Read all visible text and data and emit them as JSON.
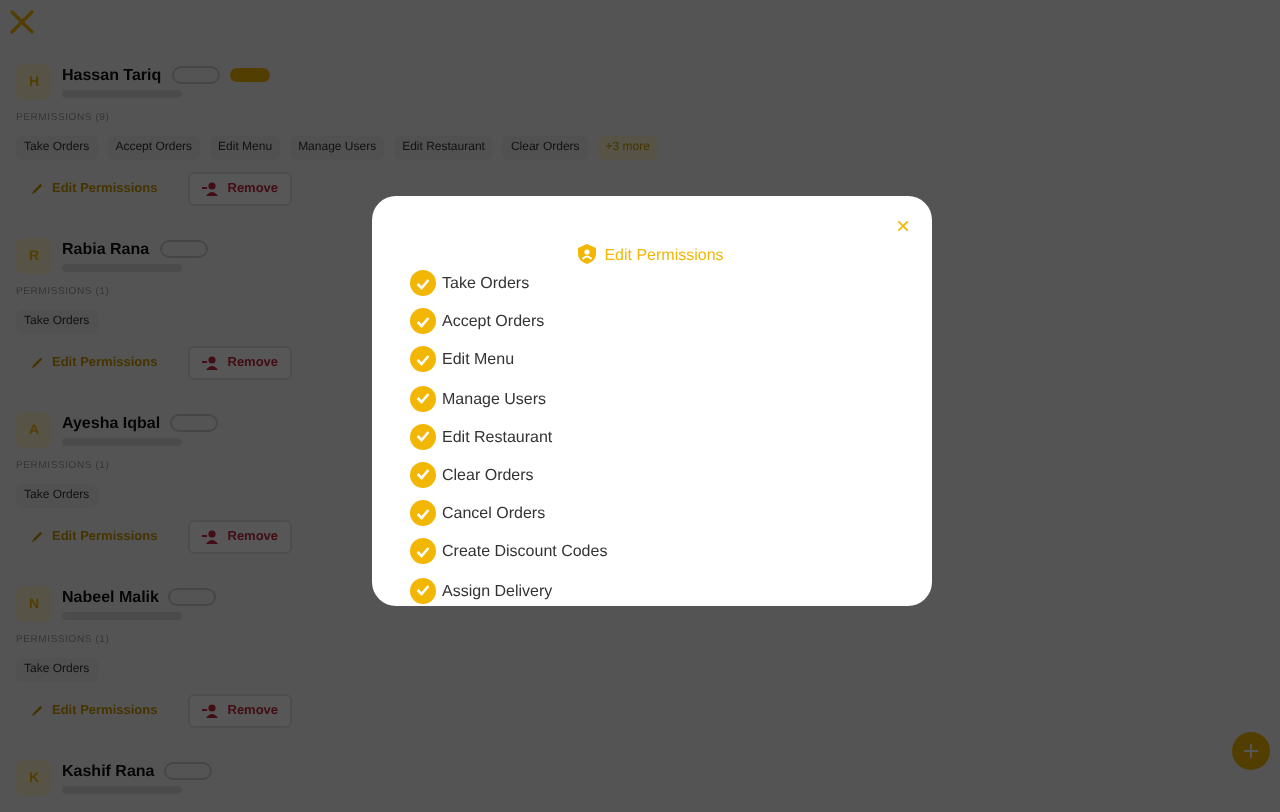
{
  "members": [
    {
      "name": "Hassan Tariq",
      "initial": "H",
      "role_badge": true,
      "permissions_label": "PERMISSIONS (9)",
      "permissions": [
        "Take Orders",
        "Accept Orders",
        "Edit Menu",
        "Manage Users",
        "Edit Restaurant",
        "Clear Orders"
      ],
      "more": "+3 more",
      "edit": "Edit Permissions",
      "remove": "Remove"
    },
    {
      "name": "Rabia Rana",
      "initial": "R",
      "role_badge": false,
      "permissions_label": "PERMISSIONS (1)",
      "permissions": [
        "Take Orders"
      ],
      "edit": "Edit Permissions",
      "remove": "Remove"
    },
    {
      "name": "Ayesha Iqbal",
      "initial": "A",
      "role_badge": false,
      "permissions_label": "PERMISSIONS (1)",
      "permissions": [
        "Take Orders"
      ],
      "edit": "Edit Permissions",
      "remove": "Remove"
    },
    {
      "name": "Nabeel Malik",
      "initial": "N",
      "role_badge": false,
      "permissions_label": "PERMISSIONS (1)",
      "permissions": [
        "Take Orders"
      ],
      "edit": "Edit Permissions",
      "remove": "Remove"
    },
    {
      "name": "Kashif Rana",
      "initial": "K",
      "role_badge": false
    }
  ],
  "dialog": {
    "title": "Edit Permissions",
    "close": "×",
    "options": [
      {
        "label": "Take Orders",
        "checked": true
      },
      {
        "label": "Accept Orders",
        "checked": true
      },
      {
        "label": "Edit Menu",
        "checked": true
      },
      {
        "label": "Manage Users",
        "checked": true
      },
      {
        "label": "Edit Restaurant",
        "checked": true
      },
      {
        "label": "Clear Orders",
        "checked": true
      },
      {
        "label": "Cancel Orders",
        "checked": true
      },
      {
        "label": "Create Discount Codes",
        "checked": true
      },
      {
        "label": "Assign Delivery",
        "checked": true
      }
    ]
  }
}
